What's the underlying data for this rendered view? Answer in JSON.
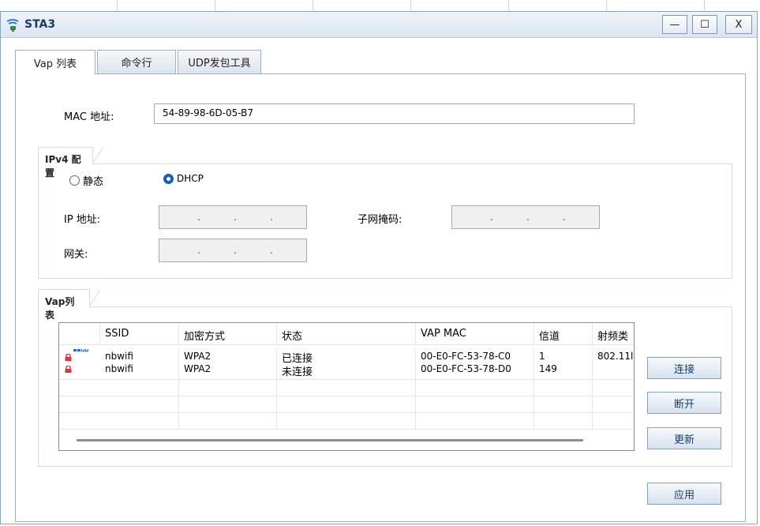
{
  "window": {
    "title": "STA3",
    "controls": {
      "minimize": "—",
      "maximize": "☐",
      "close": "X"
    }
  },
  "tabs": [
    {
      "label": "Vap 列表",
      "active": true
    },
    {
      "label": "命令行",
      "active": false
    },
    {
      "label": "UDP发包工具",
      "active": false
    }
  ],
  "mac": {
    "label": "MAC 地址:",
    "value": "54-89-98-6D-05-B7"
  },
  "ipv4": {
    "group_title": "IPv4 配置",
    "radio_static": "静态",
    "radio_dhcp": "DHCP",
    "selected": "DHCP",
    "ip_label": "IP 地址:",
    "mask_label": "子网掩码:",
    "gateway_label": "网关:",
    "ip_dots": ".",
    "dot": "."
  },
  "vap": {
    "group_title": "Vap列表",
    "columns": [
      "",
      "SSID",
      "加密方式",
      "状态",
      "VAP MAC",
      "信道",
      "射频类"
    ],
    "rows": [
      {
        "ssid": "nbwifi",
        "enc": "WPA2",
        "status": "已连接",
        "mac": "00-E0-FC-53-78-C0",
        "channel": "1",
        "radio": "802.11l"
      },
      {
        "ssid": "nbwifi",
        "enc": "WPA2",
        "status": "未连接",
        "mac": "00-E0-FC-53-78-D0",
        "channel": "149",
        "radio": ""
      }
    ]
  },
  "buttons": {
    "connect": "连接",
    "disconnect": "断开",
    "refresh": "更新",
    "apply": "应用"
  },
  "colors": {
    "accent": "#1a5fb4",
    "lock": "#d9363e",
    "signal": "#1a6fd1"
  }
}
